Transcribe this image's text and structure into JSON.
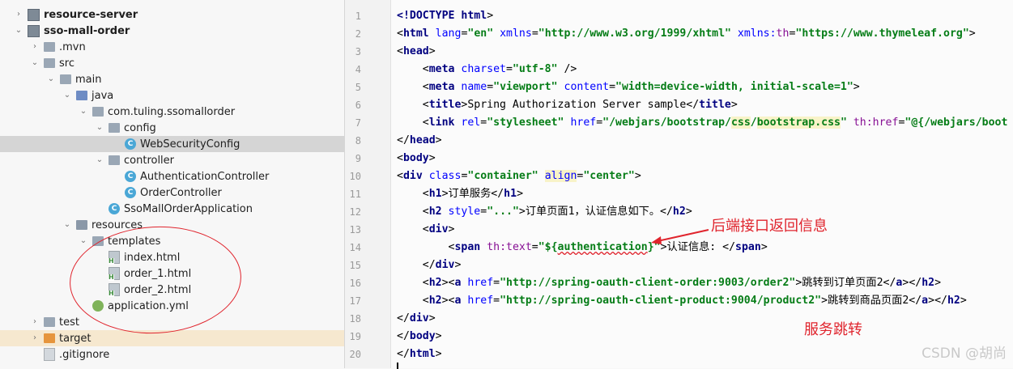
{
  "tree": [
    {
      "label": "resource-server",
      "bold": true,
      "expanded": false,
      "icon": "module-folder"
    },
    {
      "label": "sso-mall-order",
      "bold": true,
      "expanded": true,
      "icon": "module-folder"
    },
    {
      "label": ".mvn",
      "expanded": false,
      "icon": "folder"
    },
    {
      "label": "src",
      "expanded": true,
      "icon": "folder"
    },
    {
      "label": "main",
      "expanded": true,
      "icon": "folder"
    },
    {
      "label": "java",
      "expanded": true,
      "icon": "source-folder"
    },
    {
      "label": "com.tuling.ssomallorder",
      "expanded": true,
      "icon": "package-folder"
    },
    {
      "label": "config",
      "expanded": true,
      "icon": "package-folder"
    },
    {
      "label": "WebSecurityConfig",
      "icon": "java-class",
      "selected": true
    },
    {
      "label": "controller",
      "expanded": true,
      "icon": "package-folder"
    },
    {
      "label": "AuthenticationController",
      "icon": "java-class"
    },
    {
      "label": "OrderController",
      "icon": "java-class"
    },
    {
      "label": "SsoMallOrderApplication",
      "icon": "java-class"
    },
    {
      "label": "resources",
      "expanded": true,
      "icon": "resources-folder"
    },
    {
      "label": "templates",
      "expanded": true,
      "icon": "folder"
    },
    {
      "label": "index.html",
      "icon": "html-file"
    },
    {
      "label": "order_1.html",
      "icon": "html-file"
    },
    {
      "label": "order_2.html",
      "icon": "html-file"
    },
    {
      "label": "application.yml",
      "icon": "yml-file"
    },
    {
      "label": "test",
      "expanded": false,
      "icon": "folder"
    },
    {
      "label": "target",
      "expanded": false,
      "icon": "excluded-folder"
    },
    {
      "label": ".gitignore",
      "icon": "git-file"
    }
  ],
  "editor": {
    "line_numbers": [
      "1",
      "2",
      "3",
      "4",
      "5",
      "6",
      "7",
      "8",
      "9",
      "10",
      "11",
      "12",
      "13",
      "14",
      "15",
      "16",
      "17",
      "18",
      "19",
      "20"
    ]
  },
  "annotations": {
    "backend_info": "后端接口返回信息",
    "service_jump": "服务跳转"
  },
  "watermark": "CSDN @胡尚",
  "colors": {
    "annotation_red": "#e0242d",
    "tag": "#000080",
    "attr_name": "#0000ff",
    "attr_value": "#067d17",
    "thymeleaf_attr": "#871094",
    "selection": "#d5d5d5"
  }
}
